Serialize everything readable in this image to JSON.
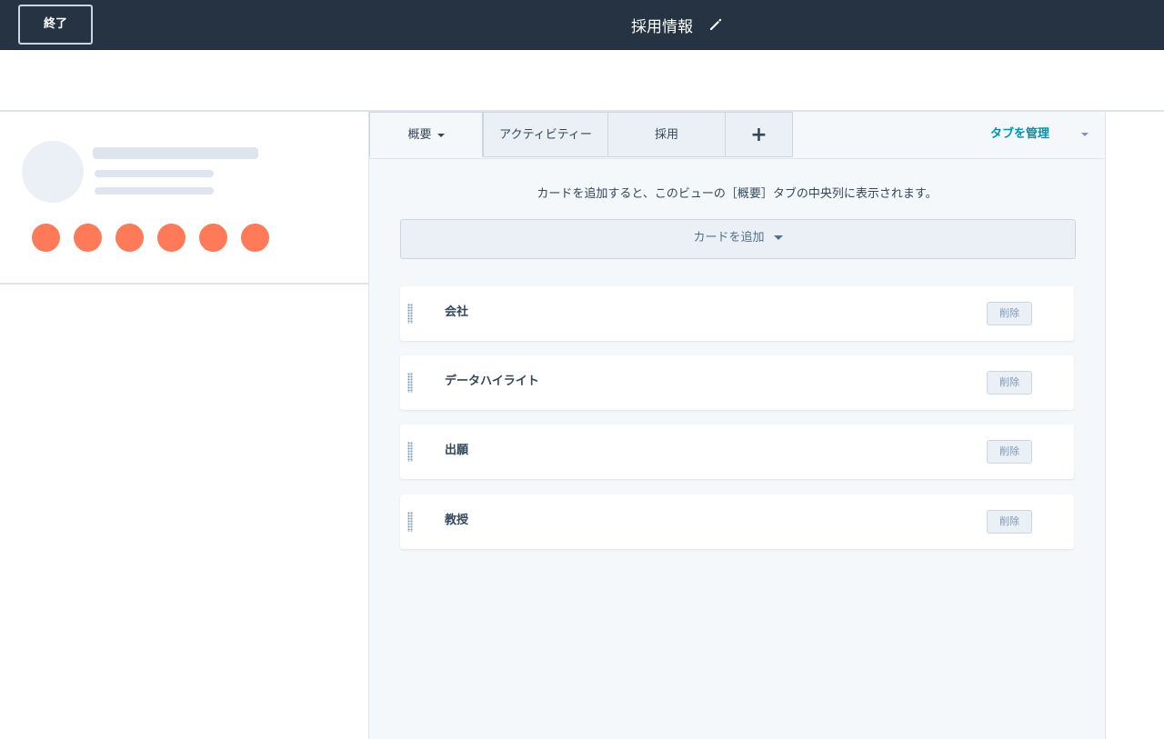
{
  "topbar": {
    "exit_label": "終了",
    "title": "採用情報",
    "edit_icon": "pencil-icon"
  },
  "tabs": [
    {
      "label": "概要",
      "active": true,
      "has_dropdown": true
    },
    {
      "label": "アクティビティー",
      "active": false
    },
    {
      "label": "採用",
      "active": false
    },
    {
      "label": "+",
      "active": false
    }
  ],
  "manage_tabs_label": "タブを管理",
  "hint_text": "カードを追加すると、このビューの［概要］タブの中央列に表示されます。",
  "add_card_label": "カードを追加",
  "cards": [
    {
      "label": "会社",
      "delete_label": "削除"
    },
    {
      "label": "データハイライト",
      "delete_label": "削除"
    },
    {
      "label": "出願",
      "delete_label": "削除"
    },
    {
      "label": "教授",
      "delete_label": "削除"
    }
  ],
  "colors": {
    "topbar": "#253342",
    "accent_link": "#0091ae",
    "action_dot": "#ff7a59"
  }
}
